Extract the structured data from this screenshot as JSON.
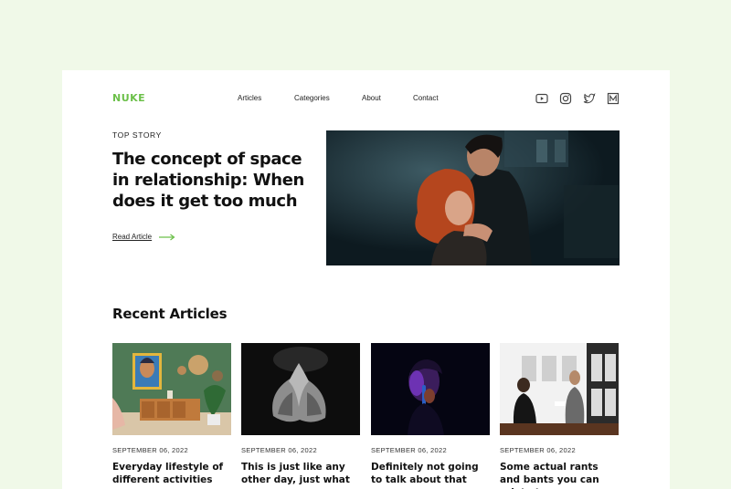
{
  "brand": {
    "logo": "NUKE",
    "accent": "#6cc04a"
  },
  "nav": {
    "items": [
      "Articles",
      "Categories",
      "About",
      "Contact"
    ]
  },
  "social": [
    "youtube-icon",
    "instagram-icon",
    "twitter-icon",
    "medium-icon"
  ],
  "hero": {
    "eyebrow": "TOP STORY",
    "title": "The concept of space in relationship: When does it get too much",
    "cta": "Read Article"
  },
  "recent": {
    "title": "Recent Articles",
    "articles": [
      {
        "date": "SEPTEMBER 06, 2022",
        "title": "Everyday lifestyle of different activities"
      },
      {
        "date": "SEPTEMBER 06, 2022",
        "title": "This is just like any other day, just what"
      },
      {
        "date": "SEPTEMBER 06, 2022",
        "title": "Definitely not going to talk about that"
      },
      {
        "date": "SEPTEMBER 06, 2022",
        "title": "Some actual rants and bants you can relate to"
      }
    ]
  },
  "colors": {
    "page_background": "#f0f9e8",
    "card": "#ffffff",
    "text": "#111111"
  }
}
